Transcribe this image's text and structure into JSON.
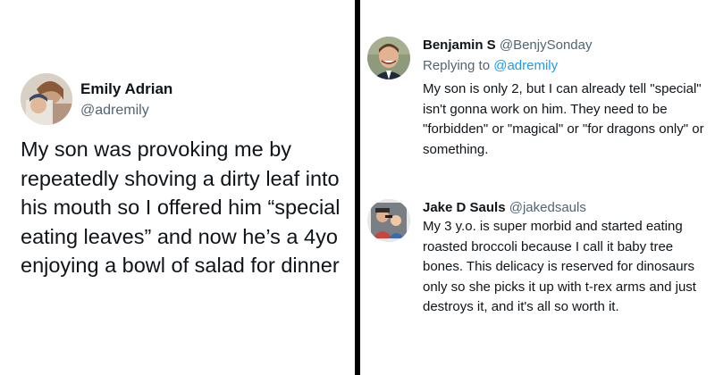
{
  "left_tweet": {
    "author_name": "Emily Adrian",
    "author_handle": "@adremily",
    "text": "My son was provoking me by repeatedly shoving a dirty leaf into his mouth so I offered him “special eating leaves” and now he’s a 4yo enjoying a bowl of salad for dinner"
  },
  "replies": [
    {
      "author_name": "Benjamin S",
      "author_handle": "@BenjySonday",
      "replying_prefix": "Replying to",
      "replying_to": "@adremily",
      "text": "My son is only 2, but I can already tell \"special\" isn't gonna work on him. They need to be \"forbidden\" or \"magical\" or \"for dragons only\" or something."
    },
    {
      "author_name": "Jake D Sauls",
      "author_handle": "@jakedsauls",
      "text": "My 3 y.o. is super morbid and started eating roasted broccoli because I call it baby tree bones.  This delicacy is reserved for dinosaurs only so she picks it up with t-rex arms and just destroys it, and it's all so worth it."
    }
  ],
  "colors": {
    "text_primary": "#0f1419",
    "text_secondary": "#536471",
    "link": "#1d9bf0",
    "divider": "#000000"
  },
  "icons": [
    "emily-avatar",
    "benjamin-avatar",
    "jake-avatar"
  ]
}
